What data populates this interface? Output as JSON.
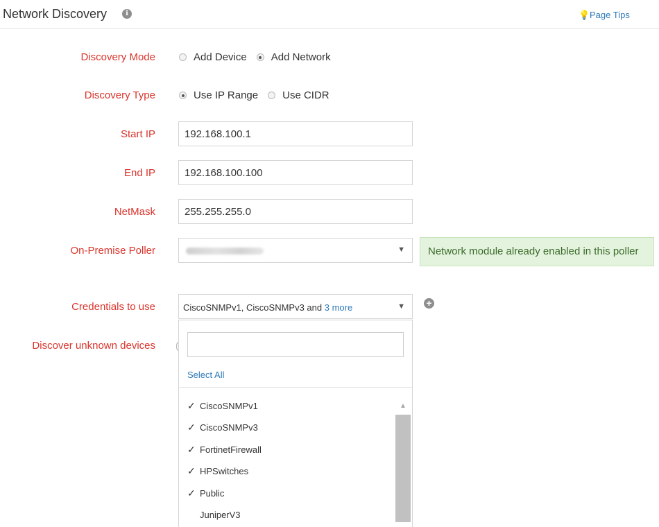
{
  "header": {
    "title": "Network Discovery",
    "info_icon": "i",
    "tips_label": "Page Tips",
    "tips_icon": "💡"
  },
  "form": {
    "discovery_mode": {
      "label": "Discovery Mode",
      "options": [
        "Add Device",
        "Add Network"
      ],
      "selected": "Add Network"
    },
    "discovery_type": {
      "label": "Discovery Type",
      "options": [
        "Use IP Range",
        "Use CIDR"
      ],
      "selected": "Use IP Range"
    },
    "start_ip": {
      "label": "Start IP",
      "value": "192.168.100.1"
    },
    "end_ip": {
      "label": "End IP",
      "value": "192.168.100.100"
    },
    "netmask": {
      "label": "NetMask",
      "value": "255.255.255.0"
    },
    "poller": {
      "label": "On-Premise Poller",
      "caret": "▼"
    },
    "notice": "Network module already enabled in this poller",
    "credentials": {
      "label": "Credentials to use",
      "summary": "CiscoSNMPv1, CiscoSNMPv3 and ",
      "more": "3 more",
      "caret": "▼",
      "add_icon": "+"
    },
    "discover_unknown": {
      "label": "Discover unknown devices"
    }
  },
  "dropdown": {
    "search_placeholder": "",
    "select_all": "Select All",
    "check_glyph": "✓",
    "scroll_up": "▲",
    "items": [
      {
        "label": "CiscoSNMPv1",
        "checked": true
      },
      {
        "label": "CiscoSNMPv3",
        "checked": true
      },
      {
        "label": "FortinetFirewall",
        "checked": true
      },
      {
        "label": "HPSwitches",
        "checked": true
      },
      {
        "label": "Public",
        "checked": true
      },
      {
        "label": "JuniperV3",
        "checked": false
      }
    ]
  }
}
